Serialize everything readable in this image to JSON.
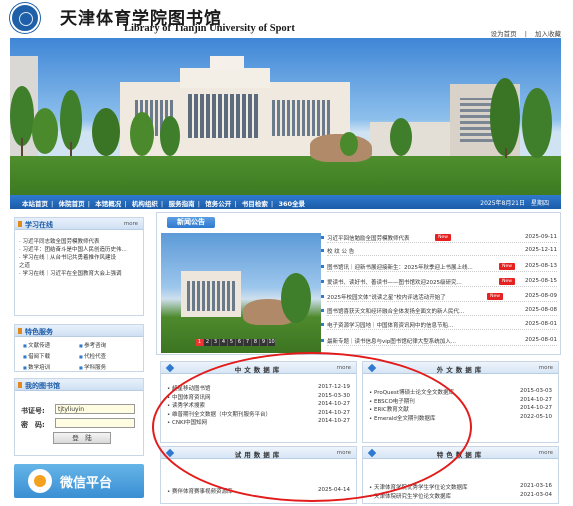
{
  "header": {
    "title_cn": "天津体育学院图书馆",
    "title_en": "Library of Tianjin University of Sport",
    "links": [
      "设为首页",
      "|",
      "加入收藏"
    ]
  },
  "nav": {
    "items": [
      "本站首页",
      "体院首页",
      "本馆概况",
      "机构组织",
      "服务指南",
      "馆务公开",
      "书目检索",
      "360全景"
    ],
    "date": "2025年8月21日　星期四"
  },
  "sidebar": {
    "study": {
      "title": "学习在线",
      "more": "more",
      "items": [
        "· 习近平同志致全国劳模教师代表",
        "· 习近平：团结奋斗是中国人民创造历史伟...",
        "· 学习在线｜从台书记共勇着推作风建设",
        "  之道",
        "· 学习在线｜习近平在全国教育大会上强调"
      ]
    },
    "features": {
      "title": "特色服务",
      "items": [
        "文献传递",
        "参考咨询",
        "借阅下载",
        "代检代查",
        "数学培训",
        "学科服务"
      ]
    },
    "mylib": {
      "title": "我的图书馆",
      "id_label": "书证号:",
      "id_value": "tjtyliuyin",
      "pw_label": "密　码:",
      "login_button": "登　陆"
    },
    "weixin": "微信平台"
  },
  "news": {
    "tab": "新闻公告",
    "pager": [
      "1",
      "2",
      "3",
      "4",
      "5",
      "6",
      "7",
      "8",
      "9",
      "10"
    ],
    "rows": [
      {
        "title": "习近平回信勉励全国劳模教师代表",
        "new": true,
        "date": "2025-09-11"
      },
      {
        "title": "校 纹 公 告",
        "new": false,
        "date": "2025-12-11"
      },
      {
        "title": "图书馆讯｜迎新书展迎接新生：2025年秋季迎上书展上线...",
        "new": true,
        "date": "2025-08-13"
      },
      {
        "title": "爱读书、读好书、善读书——图书馆欢迎2025级研究...",
        "new": true,
        "date": "2025-08-15"
      },
      {
        "title": "2025年校园文体“说读之星”校内评选活动开始了",
        "new": true,
        "date": "2025-08-09"
      },
      {
        "title": "图书馆喜获天文和经环融合全体发扬全面文的新人民代...",
        "new": false,
        "date": "2025-08-08"
      },
      {
        "title": "电子资源学习园地｜中国体育资讯网中的信息节船...",
        "new": false,
        "date": "2025-08-01"
      },
      {
        "title": "最新专题｜读书信息与vip图书馆纪律大型系统加入...",
        "new": false,
        "date": "2025-08-01"
      }
    ]
  },
  "databases": {
    "chinese": {
      "title": "中文数据库",
      "more": "more",
      "rows": [
        {
          "title": "超星移动图书馆",
          "date": "2017-12-19"
        },
        {
          "title": "中国体育资讯网",
          "date": "2015-03-30"
        },
        {
          "title": "读秀学术搜索",
          "date": "2014-10-27"
        },
        {
          "title": "维普期刊全文数据（中文期刊服务平台）",
          "date": "2014-10-27"
        },
        {
          "title": "CNKI中国知网",
          "date": "2014-10-27"
        }
      ]
    },
    "foreign": {
      "title": "外文数据库",
      "more": "more",
      "rows": [
        {
          "title": "ProQuest博硕士论文全文数据库",
          "date": "2015-03-03"
        },
        {
          "title": "EBSCO电子期刊",
          "date": "2014-10-27"
        },
        {
          "title": "ERIC教育文献",
          "date": "2014-10-27"
        },
        {
          "title": "Emerald全文期刊数据库",
          "date": "2022-05-10"
        }
      ]
    },
    "trial": {
      "title": "试用数据库",
      "more": "more",
      "rows": [
        {
          "title": "赛伴体育赛事视频资源库",
          "date": "2025-04-14"
        }
      ]
    },
    "special": {
      "title": "特色数据库",
      "more": "more",
      "rows": [
        {
          "title": "天津体育学院优秀学生学位论文数据库",
          "date": "2021-03-16"
        },
        {
          "title": "天津体院研究生学位论文数据库",
          "date": "2021-03-04"
        }
      ]
    }
  }
}
